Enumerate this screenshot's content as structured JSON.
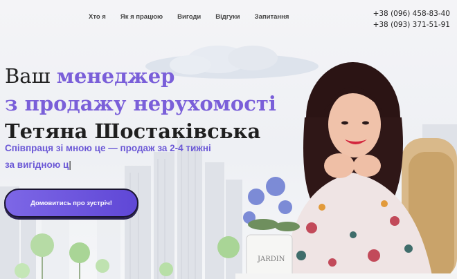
{
  "nav": {
    "items": [
      "Хто я",
      "Як я працюю",
      "Вигоди",
      "Відгуки",
      "Запитання"
    ]
  },
  "contacts": {
    "phone1": "+38 (096) 458-83-40",
    "phone2": "+38 (093) 371-51-91"
  },
  "hero": {
    "line1_prefix": "Ваш",
    "line1_accent": "менеджер",
    "line2_accent": "з продажу нерухомості",
    "line3_name": "Тетяна Шостаківська",
    "subtitle_line1": "Співпраця зі мною це — продаж за 2-4 тижні",
    "subtitle_line2": "за вигідною ц",
    "cursor": "|",
    "cta_label": "Домовитись про зустріч!"
  },
  "decor": {
    "pot_text": "JARDIN"
  },
  "colors": {
    "accent": "#7a5fd9",
    "cta_start": "#7d67e6",
    "cta_end": "#5f47d6"
  }
}
